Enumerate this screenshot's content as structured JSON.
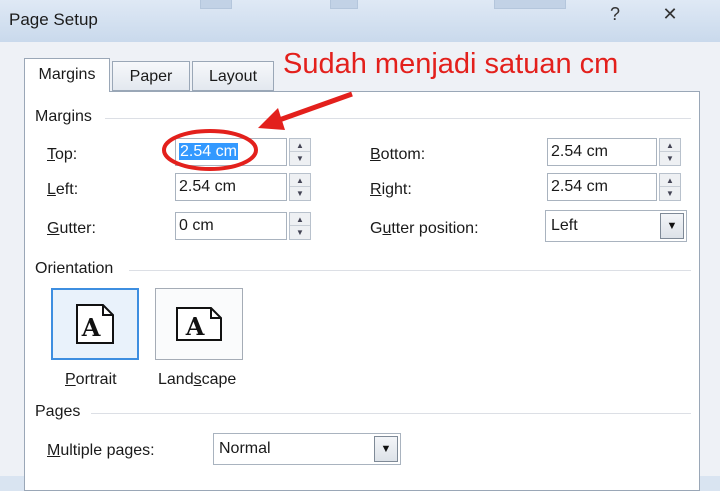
{
  "window": {
    "title": "Page Setup",
    "help_glyph": "?",
    "close_glyph": "✕"
  },
  "tabs": [
    {
      "label": "Margins",
      "active": true
    },
    {
      "label": "Paper",
      "active": false
    },
    {
      "label": "Layout",
      "active": false
    }
  ],
  "margins": {
    "group_label": "Margins",
    "top": {
      "label_key": "T",
      "label_rest": "op:",
      "value": "2.54 cm"
    },
    "left": {
      "label_key": "L",
      "label_rest": "eft:",
      "value": "2.54 cm"
    },
    "gutter": {
      "label_key": "G",
      "label_rest": "utter:",
      "value": "0 cm"
    },
    "bottom": {
      "label_key": "B",
      "label_rest": "ottom:",
      "value": "2.54 cm"
    },
    "right": {
      "label_key": "R",
      "label_rest": "ight:",
      "value": "2.54 cm"
    },
    "gutter_position": {
      "label_pre": "G",
      "label_key": "u",
      "label_rest": "tter position:",
      "value": "Left"
    }
  },
  "orientation": {
    "group_label": "Orientation",
    "portrait": {
      "label_key": "P",
      "label_rest": "ortrait",
      "glyph": "A",
      "selected": true
    },
    "landscape": {
      "label_pre": "Land",
      "label_key": "s",
      "label_rest": "cape",
      "glyph": "A",
      "selected": false
    }
  },
  "pages": {
    "group_label": "Pages",
    "multiple_pages": {
      "label_key": "M",
      "label_rest": "ultiple pages:",
      "value": "Normal"
    }
  },
  "annotation": {
    "text": "Sudah menjadi satuan cm",
    "color": "#e3201c"
  },
  "colors": {
    "selection": "#3399ff",
    "focus_border": "#3d8ee0"
  }
}
